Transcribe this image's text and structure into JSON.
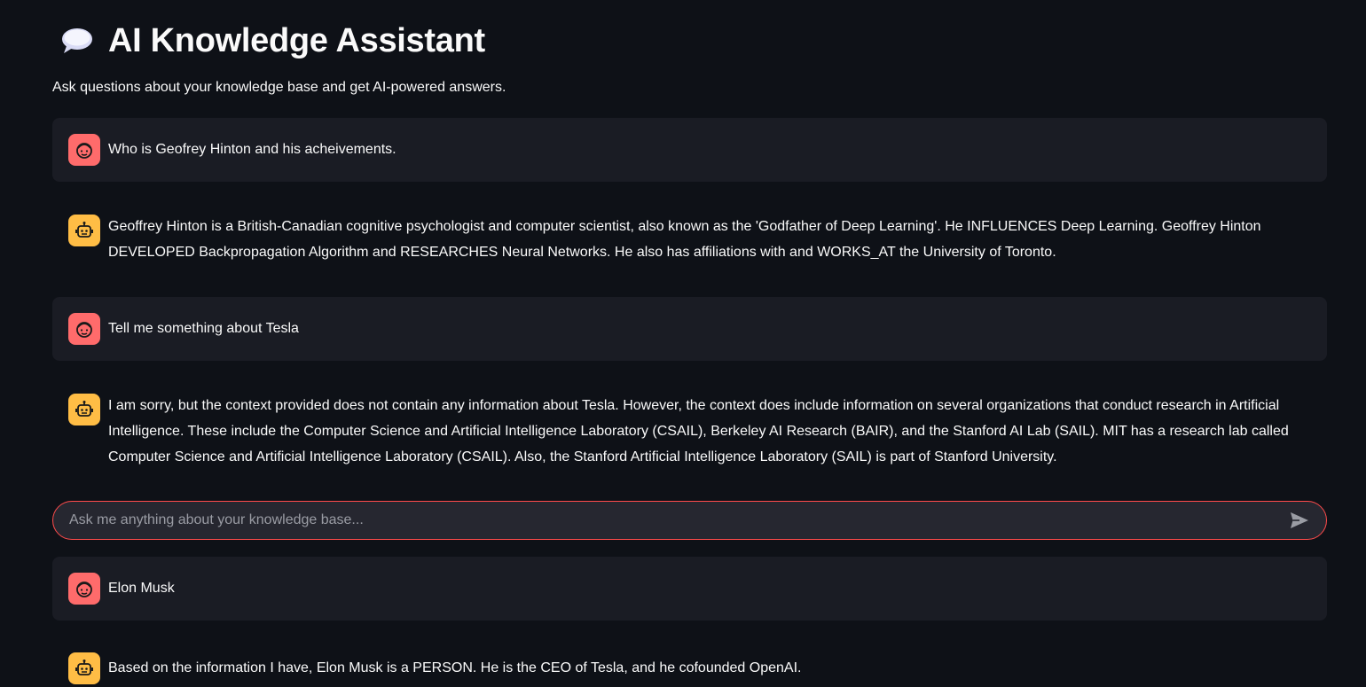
{
  "header": {
    "icon": "speech-balloon-icon",
    "title": "AI Knowledge Assistant",
    "subtitle": "Ask questions about your knowledge base and get AI-powered answers."
  },
  "colors": {
    "background": "#0e1117",
    "user_message_bg": "#1a1c24",
    "user_avatar": "#ff6b6b",
    "assistant_avatar": "#ffbd45",
    "input_border": "#ff4b4b",
    "input_bg": "#262730"
  },
  "messages": [
    {
      "role": "user",
      "avatar_icon": "user-face-icon",
      "text": "Who is Geofrey Hinton and his acheivements."
    },
    {
      "role": "assistant",
      "avatar_icon": "robot-icon",
      "text": "Geoffrey Hinton is a British-Canadian cognitive psychologist and computer scientist, also known as the 'Godfather of Deep Learning'. He INFLUENCES Deep Learning. Geoffrey Hinton DEVELOPED Backpropagation Algorithm and RESEARCHES Neural Networks. He also has affiliations with and WORKS_AT the University of Toronto."
    },
    {
      "role": "user",
      "avatar_icon": "user-face-icon",
      "text": "Tell me something about Tesla"
    },
    {
      "role": "assistant",
      "avatar_icon": "robot-icon",
      "text": "I am sorry, but the context provided does not contain any information about Tesla. However, the context does include information on several organizations that conduct research in Artificial Intelligence. These include the Computer Science and Artificial Intelligence Laboratory (CSAIL), Berkeley AI Research (BAIR), and the Stanford AI Lab (SAIL). MIT has a research lab called Computer Science and Artificial Intelligence Laboratory (CSAIL). Also, the Stanford Artificial Intelligence Laboratory (SAIL) is part of Stanford University."
    },
    {
      "role": "user",
      "avatar_icon": "user-face-icon",
      "text": "Elon Musk"
    },
    {
      "role": "assistant",
      "avatar_icon": "robot-icon",
      "text": "Based on the information I have, Elon Musk is a PERSON. He is the CEO of Tesla, and he cofounded OpenAI."
    }
  ],
  "chat_input": {
    "value": "",
    "placeholder": "Ask me anything about your knowledge base...",
    "send_icon": "send-icon"
  }
}
